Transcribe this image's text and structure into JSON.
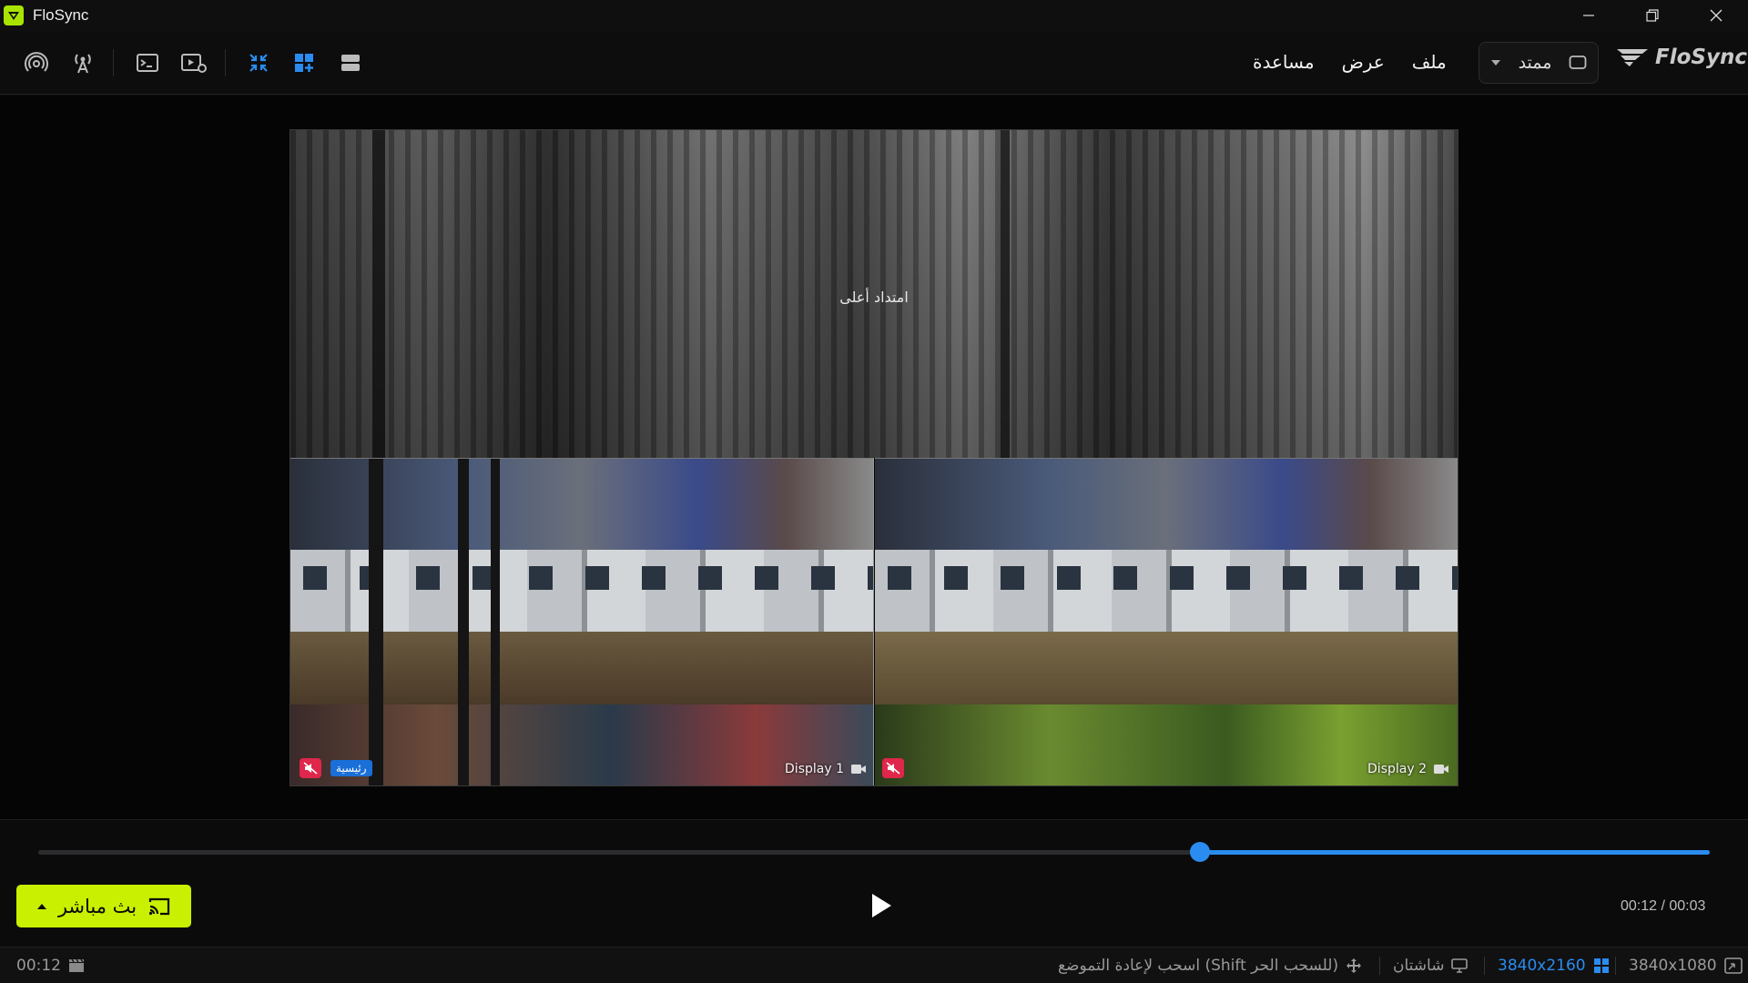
{
  "app": {
    "title": "FloSync",
    "brand": "FloSync"
  },
  "menu": {
    "file": "ملف",
    "view": "عرض",
    "help": "مساعدة"
  },
  "mode": {
    "selected": "ممتد"
  },
  "toolbar": {
    "icons": [
      "broadcast-icon",
      "antenna-icon",
      "terminal-icon",
      "video-settings-icon",
      "shrink-icon",
      "grid-add-icon",
      "rows-icon"
    ]
  },
  "preview": {
    "extension_label": "امتداد أعلى",
    "displays": [
      {
        "name": "Display 1",
        "tag": "رئيسية",
        "muted": true
      },
      {
        "name": "Display 2",
        "muted": true
      }
    ]
  },
  "playback": {
    "progress": 0.695,
    "time": "00:12 / 00:03",
    "live_label": "بث مباشر"
  },
  "status": {
    "output_resolution": "3840x1080",
    "canvas_resolution": "3840x2160",
    "screens": "شاشتان",
    "hint": "اسحب لإعادة التموضع (Shift للسحب الحر)",
    "clip_time": "00:12"
  },
  "colors": {
    "accent": "#2a8cf0",
    "live": "#c8f000",
    "mute": "#e0264a",
    "tag": "#1a6fd8"
  }
}
